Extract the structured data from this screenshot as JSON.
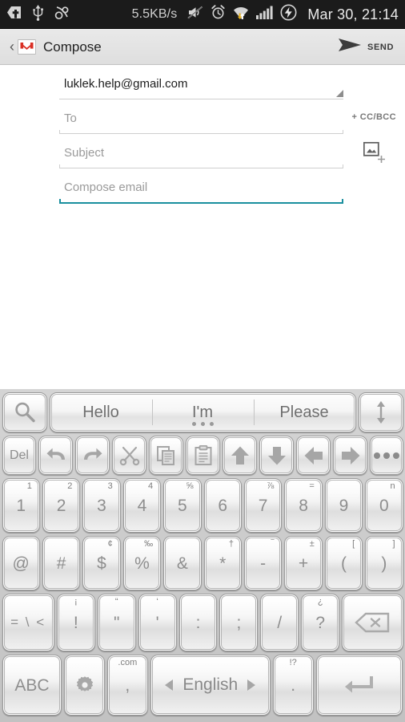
{
  "statusbar": {
    "icons_left": [
      "back-plus-icon",
      "usb-icon",
      "link-icon"
    ],
    "network_speed": "5.5KB/s",
    "icons_right": [
      "mute-icon",
      "alarm-icon",
      "wifi-transfer-icon",
      "signal-bars-icon",
      "battery-charging-icon"
    ],
    "clock": "Mar 30, 21:14"
  },
  "actionbar": {
    "back_glyph": "‹",
    "app_icon": "gmail-logo",
    "title": "Compose",
    "send_label": "SEND"
  },
  "compose": {
    "from_value": "luklek.help@gmail.com",
    "to_placeholder": "To",
    "ccbcc_label": "+ CC/BCC",
    "subject_placeholder": "Subject",
    "body_placeholder": "Compose email",
    "attach_icon": "add-image-icon",
    "active_underline_color": "#1a8f9e"
  },
  "keyboard": {
    "suggestions": {
      "search_icon": "search-icon",
      "items": [
        {
          "text": "Hello",
          "has_dots": false
        },
        {
          "text": "I'm",
          "has_dots": true
        },
        {
          "text": "Please",
          "has_dots": false
        }
      ],
      "resize_icon": "resize-vertical-icon"
    },
    "toolbar": [
      {
        "name": "del-key",
        "label": "Del",
        "icon": ""
      },
      {
        "name": "undo-key",
        "label": "",
        "icon": "undo-icon"
      },
      {
        "name": "redo-key",
        "label": "",
        "icon": "redo-icon"
      },
      {
        "name": "cut-key",
        "label": "",
        "icon": "scissors-icon"
      },
      {
        "name": "copy-key",
        "label": "",
        "icon": "copy-icon"
      },
      {
        "name": "paste-key",
        "label": "",
        "icon": "clipboard-icon"
      },
      {
        "name": "arrow-up-key",
        "label": "",
        "icon": "arrow-up-icon"
      },
      {
        "name": "arrow-down-key",
        "label": "",
        "icon": "arrow-down-icon"
      },
      {
        "name": "arrow-left-key",
        "label": "",
        "icon": "arrow-left-icon"
      },
      {
        "name": "arrow-right-key",
        "label": "",
        "icon": "arrow-right-icon"
      },
      {
        "name": "more-key",
        "label": "",
        "icon": "ellipsis-icon"
      }
    ],
    "row_numbers": [
      {
        "label": "1",
        "hint": "1"
      },
      {
        "label": "2",
        "hint": "2"
      },
      {
        "label": "3",
        "hint": "3"
      },
      {
        "label": "4",
        "hint": "4"
      },
      {
        "label": "5",
        "hint": "⅝"
      },
      {
        "label": "6",
        "hint": ""
      },
      {
        "label": "7",
        "hint": "⅞"
      },
      {
        "label": "8",
        "hint": "="
      },
      {
        "label": "9",
        "hint": ""
      },
      {
        "label": "0",
        "hint": "n"
      }
    ],
    "row_symbols": [
      {
        "label": "@",
        "hint": ""
      },
      {
        "label": "#",
        "hint": ""
      },
      {
        "label": "$",
        "hint": "¢"
      },
      {
        "label": "%",
        "hint": "‰"
      },
      {
        "label": "&",
        "hint": ""
      },
      {
        "label": "*",
        "hint": "†"
      },
      {
        "label": "-",
        "hint": "‾"
      },
      {
        "label": "+",
        "hint": "±"
      },
      {
        "label": "(",
        "hint": "["
      },
      {
        "label": ")",
        "hint": "]"
      }
    ],
    "row_punct": {
      "modifier_label": "= \\ <",
      "keys": [
        {
          "label": "!",
          "hint": "¡"
        },
        {
          "label": "\"",
          "hint": "“"
        },
        {
          "label": "'",
          "hint": "‘"
        },
        {
          "label": ":",
          "hint": ""
        },
        {
          "label": ";",
          "hint": ""
        },
        {
          "label": "/",
          "hint": ""
        },
        {
          "label": "?",
          "hint": "¿"
        }
      ],
      "backspace_icon": "backspace-icon"
    },
    "row_bottom": {
      "abc_label": "ABC",
      "settings_icon": "gear-icon",
      "comma_label": ",",
      "comma_hint": ".com",
      "space_label": "English",
      "space_prev_icon": "triangle-left-icon",
      "space_next_icon": "triangle-right-icon",
      "period_label": ".",
      "period_hint": "!?",
      "enter_icon": "enter-icon"
    }
  }
}
